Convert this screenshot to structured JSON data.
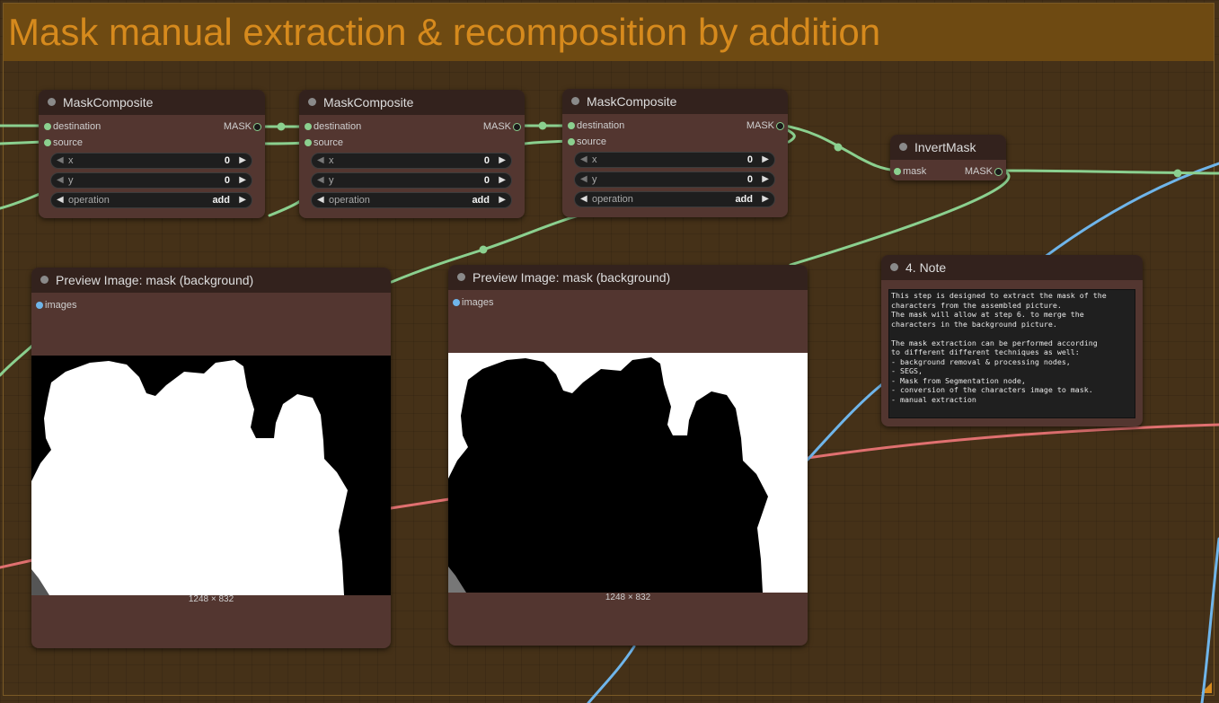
{
  "group": {
    "title": "Mask manual extraction & recomposition by addition",
    "title_color": "#d68a1d",
    "header_color": "#6e4a12"
  },
  "nodes": {
    "mask_composite_1": {
      "title": "MaskComposite",
      "inputs": [
        "destination",
        "source"
      ],
      "output": "MASK",
      "widgets": {
        "x_label": "x",
        "x_value": "0",
        "y_label": "y",
        "y_value": "0",
        "op_label": "operation",
        "op_value": "add"
      }
    },
    "mask_composite_2": {
      "title": "MaskComposite",
      "inputs": [
        "destination",
        "source"
      ],
      "output": "MASK",
      "widgets": {
        "x_label": "x",
        "x_value": "0",
        "y_label": "y",
        "y_value": "0",
        "op_label": "operation",
        "op_value": "add"
      }
    },
    "mask_composite_3": {
      "title": "MaskComposite",
      "inputs": [
        "destination",
        "source"
      ],
      "output": "MASK",
      "widgets": {
        "x_label": "x",
        "x_value": "0",
        "y_label": "y",
        "y_value": "0",
        "op_label": "operation",
        "op_value": "add"
      }
    },
    "invert_mask": {
      "title": "InvertMask",
      "input": "mask",
      "output": "MASK"
    },
    "preview_1": {
      "title": "Preview Image: mask (background)",
      "input": "images",
      "dimensions": "1248 × 832",
      "mask_style": "white silhouettes on black"
    },
    "preview_2": {
      "title": "Preview Image: mask (background)",
      "input": "images",
      "dimensions": "1248 × 832",
      "mask_style": "black silhouettes on white"
    },
    "note": {
      "title": "4. Note",
      "text": "This step is designed to extract the mask of the\ncharacters from the assembled picture.\nThe mask will allow at step 6. to merge the\ncharacters in the background picture.\n\nThe mask extraction can be performed according\nto different different techniques as well:\n- background removal & processing nodes,\n- SEGS,\n- Mask from Segmentation node,\n- conversion of the characters image to mask.\n- manual extraction"
    }
  },
  "colors": {
    "canvas": "#453118",
    "node_body": "#533630",
    "node_title": "#33221d",
    "mask_wire": "#8bd08f",
    "image_wire": "#6fb5ea",
    "latent_wire": "#e07070"
  },
  "icons": {
    "decrement": "left-arrow-icon",
    "increment": "right-arrow-icon",
    "node_collapse": "dot-icon"
  }
}
